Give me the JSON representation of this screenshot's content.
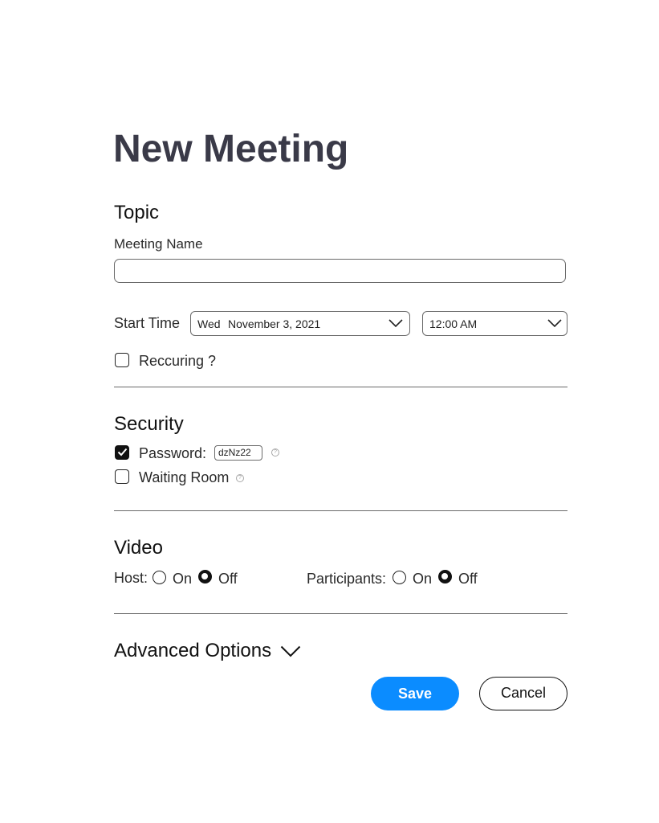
{
  "title": "New Meeting",
  "topic": {
    "heading": "Topic",
    "meeting_name_label": "Meeting Name",
    "meeting_name_value": "",
    "start_time_label": "Start Time",
    "date_day": "Wed",
    "date_value": "November 3, 2021",
    "time_value": "12:00 AM",
    "recurring_label": "Reccuring ?",
    "recurring_checked": false
  },
  "security": {
    "heading": "Security",
    "password_label": "Password:",
    "password_value": "dzNz22",
    "password_checked": true,
    "waiting_room_label": "Waiting Room",
    "waiting_room_checked": false
  },
  "video": {
    "heading": "Video",
    "host_label": "Host:",
    "participants_label": "Participants:",
    "on_label": "On",
    "off_label": "Off",
    "host_selected": "Off",
    "participants_selected": "Off"
  },
  "advanced": {
    "label": "Advanced Options"
  },
  "actions": {
    "save_label": "Save",
    "cancel_label": "Cancel"
  },
  "colors": {
    "accent": "#0b8cff",
    "title": "#3a3a48"
  },
  "icons": {
    "dropdown": "chevron-down-icon",
    "check": "checkmark-icon",
    "help": "help-icon"
  }
}
